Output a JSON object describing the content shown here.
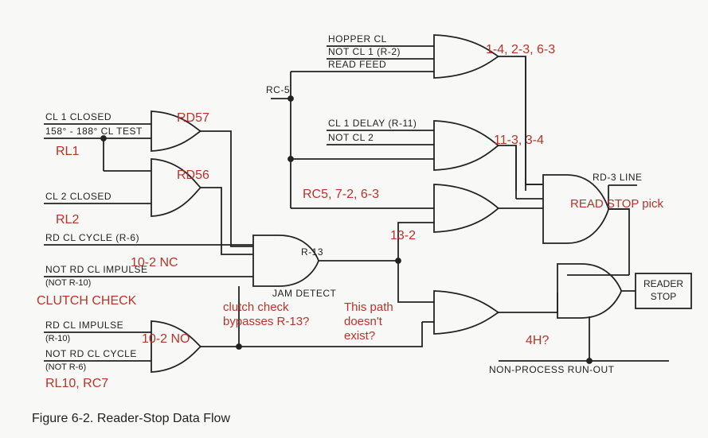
{
  "figure": {
    "caption": "Figure  6-2.    Reader-Stop Data Flow"
  },
  "signals": {
    "cl1_closed": "CL 1 CLOSED",
    "cl_test": "158° - 188° CL TEST",
    "cl2_closed": "CL 2 CLOSED",
    "rd_cl_cycle": "RD CL CYCLE (R-6)",
    "not_rd_cl_impulse": "NOT RD CL IMPULSE",
    "not_r10": "(NOT R-10)",
    "rd_cl_impulse": "RD CL IMPULSE",
    "r10": "(R-10)",
    "not_rd_cl_cycle": "NOT RD CL CYCLE",
    "not_r6": "(NOT R-6)",
    "rc5": "RC-5",
    "hopper_cl": "HOPPER CL",
    "not_cl1_r2": "NOT CL 1 (R-2)",
    "read_feed": "READ FEED",
    "cl1_delay": "CL 1 DELAY (R-11)",
    "not_cl2": "NOT CL 2",
    "r13": "R-13",
    "jam_detect": "JAM DETECT",
    "rd3_line": "RD-3 LINE",
    "non_process_runout": "NON-PROCESS RUN-OUT"
  },
  "box": {
    "reader_stop_1": "READER",
    "reader_stop_2": "STOP"
  },
  "annotations": {
    "rl1": "RL1",
    "rd57": "RD57",
    "rd56": "RD56",
    "rl2": "RL2",
    "ten2_nc": "10-2 NC",
    "clutch_check": "CLUTCH CHECK",
    "ten2_no": "10-2 NO",
    "rl10_rc7": "RL10, RC7",
    "clutch_bypass1": "clutch check",
    "clutch_bypass2": "bypasses R-13?",
    "path_not_exist1": "This path",
    "path_not_exist2": "doesn't",
    "path_not_exist3": "exist?",
    "rc5_72_63": "RC5, 7-2, 6-3",
    "thirteen2": "13-2",
    "one4_23_63": "1-4, 2-3, 6-3",
    "eleven3_34": "11-3, 3-4",
    "read_stop_pick": "READ STOP pick",
    "four_h": "4H?"
  }
}
